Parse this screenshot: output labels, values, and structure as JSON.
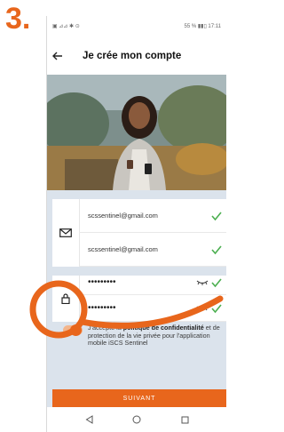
{
  "step_label": "3.",
  "status_bar": {
    "left": "▣ ⊿⊿ ✱ ⊙",
    "right": "55 % ▮▮▯ 17:11"
  },
  "header": {
    "title": "Je crée mon compte",
    "back_icon": "arrow-left-icon"
  },
  "form": {
    "email": {
      "value": "scssentinel@gmail.com",
      "icon": "envelope-icon"
    },
    "email_confirm": {
      "value": "scssentinel@gmail.com"
    },
    "password": {
      "value": "•••••••••",
      "icon": "lock-icon"
    },
    "password_confirm": {
      "value": "•••••••••"
    }
  },
  "consent": {
    "checked": true,
    "text_before": "J'accepte la ",
    "text_bold": "politique de confidentialité",
    "text_middle": " et de protection de la vie privée",
    "text_after": " pour l'application mobile iSCS Sentinel"
  },
  "submit_label": "SUIVANT",
  "nav": {
    "back_icon": "triangle-back-icon",
    "home_icon": "circle-home-icon",
    "recents_icon": "square-recents-icon"
  },
  "colors": {
    "accent": "#e8661c",
    "form_bg": "#dbe3ec",
    "check": "#4caf50"
  }
}
